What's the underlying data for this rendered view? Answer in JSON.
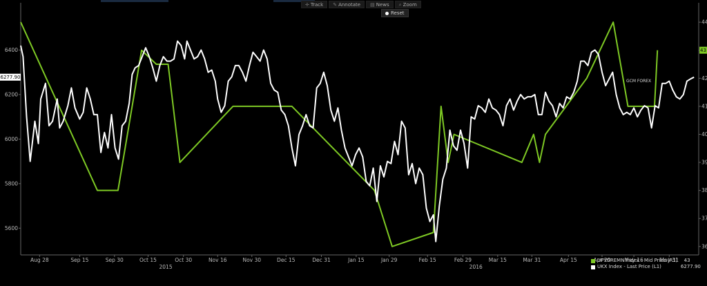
{
  "toolbar": {
    "track": "Track",
    "annotate": "Annotate",
    "news": "News",
    "zoom": "Zoom",
    "reset": "Reset"
  },
  "colors": {
    "green": "#7ec924",
    "white": "#ffffff",
    "background": "#000000",
    "axis": "#666666"
  },
  "chart_data": {
    "type": "line",
    "x_labels": [
      "Aug 28",
      "Sep 15",
      "Sep 30",
      "Oct 15",
      "Oct 30",
      "Nov 16",
      "Nov 30",
      "Dec 15",
      "Dec 31",
      "Jan 15",
      "Jan 29",
      "Feb 15",
      "Feb 29",
      "Mar 15",
      "Mar 31",
      "Apr 15",
      "Apr 29",
      "May 16",
      "May 31"
    ],
    "year_labels": [
      "2015",
      "2016"
    ],
    "left_axis": {
      "ticks": [
        5600,
        5800,
        6000,
        6200,
        6400
      ],
      "ylim": [
        5480,
        6550
      ]
    },
    "right_axis": {
      "ticks": [
        36,
        37,
        38,
        39,
        40,
        41,
        42,
        43,
        44
      ],
      "ylim": [
        35.7,
        44.2
      ]
    },
    "annotation": "GCM FOREX",
    "last_value_left": "6277.90",
    "last_value_right": "43",
    "series": [
      {
        "name": "UPYGREMN Index - Mid Price (R1)",
        "last": "43",
        "axis": "right",
        "points": [
          [
            0,
            44
          ],
          [
            13,
            38
          ],
          [
            16.5,
            38
          ],
          [
            20.5,
            43
          ],
          [
            23,
            42.5
          ],
          [
            25,
            42.5
          ],
          [
            27,
            39
          ],
          [
            36,
            41
          ],
          [
            46,
            41
          ],
          [
            60,
            38
          ],
          [
            63,
            36
          ],
          [
            70,
            36.5
          ],
          [
            71.3,
            41
          ],
          [
            72.5,
            39
          ],
          [
            73.5,
            40
          ],
          [
            85,
            39
          ],
          [
            87,
            40
          ],
          [
            88,
            39
          ],
          [
            89,
            40
          ],
          [
            96,
            42
          ],
          [
            100.5,
            44
          ],
          [
            103,
            41
          ],
          [
            107.5,
            41
          ],
          [
            108,
            43
          ]
        ]
      },
      {
        "name": "UKX Index - Last Price (L1)",
        "last": "6277.90",
        "axis": "left",
        "points": [
          [
            0,
            6420
          ],
          [
            0.4,
            6370
          ],
          [
            1,
            6100
          ],
          [
            1.6,
            5900
          ],
          [
            2.4,
            6080
          ],
          [
            3,
            5980
          ],
          [
            3.4,
            6180
          ],
          [
            4.2,
            6250
          ],
          [
            4.8,
            6060
          ],
          [
            5.4,
            6080
          ],
          [
            6.2,
            6180
          ],
          [
            6.6,
            6050
          ],
          [
            7.2,
            6080
          ],
          [
            8,
            6150
          ],
          [
            8.6,
            6230
          ],
          [
            9.2,
            6140
          ],
          [
            10,
            6090
          ],
          [
            10.6,
            6120
          ],
          [
            11.2,
            6230
          ],
          [
            11.8,
            6180
          ],
          [
            12.4,
            6110
          ],
          [
            13,
            6110
          ],
          [
            13.6,
            5940
          ],
          [
            14.2,
            6030
          ],
          [
            14.8,
            5960
          ],
          [
            15.4,
            6110
          ],
          [
            16,
            5960
          ],
          [
            16.6,
            5910
          ],
          [
            17.2,
            6060
          ],
          [
            17.8,
            6080
          ],
          [
            18.4,
            6160
          ],
          [
            18.9,
            6290
          ],
          [
            19.4,
            6320
          ],
          [
            20,
            6330
          ],
          [
            20.6,
            6370
          ],
          [
            21.2,
            6410
          ],
          [
            21.8,
            6370
          ],
          [
            22.4,
            6320
          ],
          [
            23,
            6260
          ],
          [
            23.6,
            6330
          ],
          [
            24.2,
            6370
          ],
          [
            24.8,
            6350
          ],
          [
            25.4,
            6350
          ],
          [
            26,
            6360
          ],
          [
            26.6,
            6440
          ],
          [
            27.2,
            6420
          ],
          [
            27.8,
            6360
          ],
          [
            28.2,
            6440
          ],
          [
            28.8,
            6400
          ],
          [
            29.4,
            6360
          ],
          [
            30,
            6370
          ],
          [
            30.6,
            6400
          ],
          [
            31.2,
            6360
          ],
          [
            31.8,
            6300
          ],
          [
            32.4,
            6310
          ],
          [
            33,
            6260
          ],
          [
            33.4,
            6180
          ],
          [
            34,
            6120
          ],
          [
            34.6,
            6150
          ],
          [
            35.2,
            6260
          ],
          [
            35.8,
            6280
          ],
          [
            36.4,
            6330
          ],
          [
            37,
            6330
          ],
          [
            37.6,
            6300
          ],
          [
            38.2,
            6260
          ],
          [
            38.8,
            6330
          ],
          [
            39.4,
            6390
          ],
          [
            40,
            6370
          ],
          [
            40.6,
            6350
          ],
          [
            41.2,
            6400
          ],
          [
            41.8,
            6360
          ],
          [
            42.4,
            6250
          ],
          [
            43,
            6220
          ],
          [
            43.6,
            6210
          ],
          [
            44.2,
            6130
          ],
          [
            44.8,
            6110
          ],
          [
            45.4,
            6060
          ],
          [
            46,
            5960
          ],
          [
            46.6,
            5880
          ],
          [
            47.2,
            6020
          ],
          [
            47.8,
            6060
          ],
          [
            48.4,
            6110
          ],
          [
            49,
            6060
          ],
          [
            49.6,
            6050
          ],
          [
            50.2,
            6230
          ],
          [
            50.8,
            6250
          ],
          [
            51.4,
            6300
          ],
          [
            52,
            6240
          ],
          [
            52.6,
            6130
          ],
          [
            53.2,
            6080
          ],
          [
            53.8,
            6140
          ],
          [
            54.4,
            6040
          ],
          [
            55,
            5960
          ],
          [
            55.6,
            5920
          ],
          [
            56.2,
            5880
          ],
          [
            56.8,
            5930
          ],
          [
            57.4,
            5960
          ],
          [
            58,
            5920
          ],
          [
            58.6,
            5810
          ],
          [
            59.2,
            5790
          ],
          [
            59.8,
            5870
          ],
          [
            60.4,
            5720
          ],
          [
            61,
            5880
          ],
          [
            61.6,
            5830
          ],
          [
            62.2,
            5900
          ],
          [
            62.8,
            5890
          ],
          [
            63.4,
            5990
          ],
          [
            64,
            5930
          ],
          [
            64.6,
            6080
          ],
          [
            65.2,
            6050
          ],
          [
            65.8,
            5840
          ],
          [
            66.4,
            5890
          ],
          [
            67,
            5800
          ],
          [
            67.6,
            5870
          ],
          [
            68.2,
            5840
          ],
          [
            68.8,
            5690
          ],
          [
            69.4,
            5630
          ],
          [
            70,
            5660
          ],
          [
            70.4,
            5540
          ],
          [
            71,
            5700
          ],
          [
            71.6,
            5820
          ],
          [
            72.2,
            5870
          ],
          [
            72.8,
            6040
          ],
          [
            73.4,
            5970
          ],
          [
            74,
            5950
          ],
          [
            74.6,
            6040
          ],
          [
            75.2,
            5980
          ],
          [
            75.8,
            5870
          ],
          [
            76.4,
            6100
          ],
          [
            77,
            6090
          ],
          [
            77.6,
            6150
          ],
          [
            78.2,
            6140
          ],
          [
            78.8,
            6120
          ],
          [
            79.4,
            6180
          ],
          [
            80,
            6140
          ],
          [
            80.6,
            6130
          ],
          [
            81.2,
            6110
          ],
          [
            81.8,
            6060
          ],
          [
            82.4,
            6150
          ],
          [
            83,
            6180
          ],
          [
            83.6,
            6130
          ],
          [
            84.2,
            6170
          ],
          [
            84.8,
            6200
          ],
          [
            85.4,
            6180
          ],
          [
            86,
            6190
          ],
          [
            86.6,
            6190
          ],
          [
            87.2,
            6200
          ],
          [
            87.8,
            6110
          ],
          [
            88.4,
            6110
          ],
          [
            89,
            6210
          ],
          [
            89.6,
            6170
          ],
          [
            90.2,
            6150
          ],
          [
            90.8,
            6100
          ],
          [
            91.4,
            6160
          ],
          [
            92,
            6140
          ],
          [
            92.6,
            6190
          ],
          [
            93.2,
            6180
          ],
          [
            93.8,
            6210
          ],
          [
            94.4,
            6260
          ],
          [
            95,
            6350
          ],
          [
            95.6,
            6350
          ],
          [
            96.2,
            6330
          ],
          [
            96.8,
            6390
          ],
          [
            97.4,
            6400
          ],
          [
            98,
            6380
          ],
          [
            98.6,
            6300
          ],
          [
            99.2,
            6240
          ],
          [
            99.8,
            6270
          ],
          [
            100.4,
            6300
          ],
          [
            101,
            6200
          ],
          [
            101.6,
            6140
          ],
          [
            102.2,
            6110
          ],
          [
            102.8,
            6120
          ],
          [
            103.4,
            6110
          ],
          [
            104,
            6140
          ],
          [
            104.6,
            6100
          ],
          [
            105.2,
            6130
          ],
          [
            105.8,
            6150
          ],
          [
            106.4,
            6140
          ],
          [
            107,
            6050
          ],
          [
            107.6,
            6150
          ],
          [
            108.2,
            6140
          ],
          [
            108.8,
            6250
          ],
          [
            109.4,
            6250
          ],
          [
            110,
            6260
          ],
          [
            110.6,
            6220
          ],
          [
            111.2,
            6190
          ],
          [
            111.8,
            6180
          ],
          [
            112.4,
            6200
          ],
          [
            113,
            6260
          ],
          [
            113.6,
            6270
          ],
          [
            114.2,
            6278
          ]
        ]
      }
    ]
  }
}
